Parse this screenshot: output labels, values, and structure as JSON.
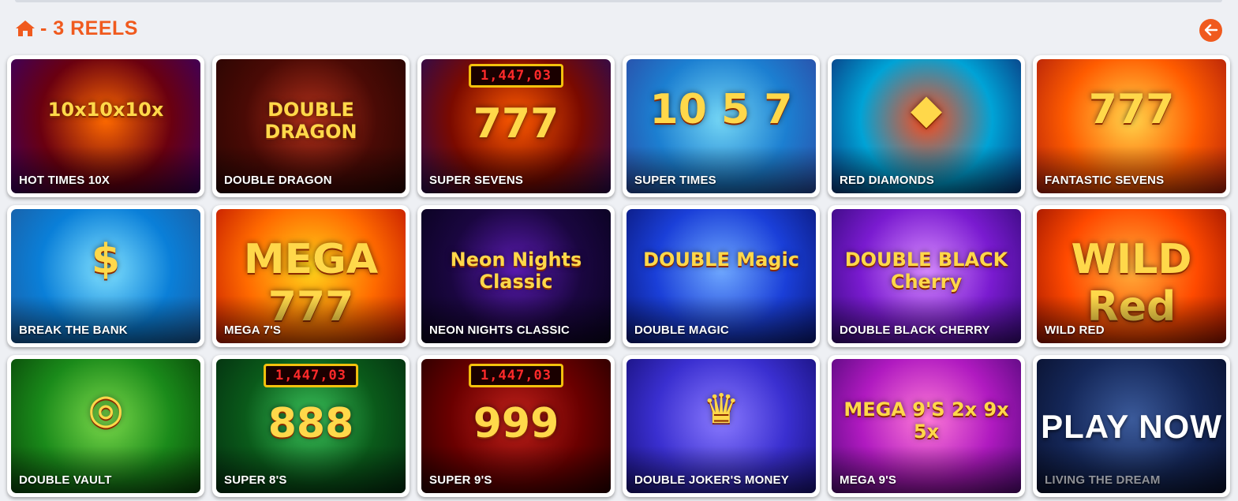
{
  "header": {
    "title": "- 3 REELS",
    "accent_color": "#f05a1e",
    "home_icon": "home-icon",
    "back_icon": "arrow-left-icon"
  },
  "games": [
    {
      "name": "HOT TIMES 10X",
      "art_text": "10x10x10x",
      "colors": [
        "#6a0010",
        "#ff6a00",
        "#3b0060"
      ]
    },
    {
      "name": "DOUBLE DRAGON",
      "art_text": "DOUBLE DRAGON",
      "colors": [
        "#4a0a05",
        "#b1301a",
        "#2a0603"
      ]
    },
    {
      "name": "SUPER SEVENS",
      "art_text": "777",
      "jackpot": "1,447,03",
      "colors": [
        "#7a0a00",
        "#ff5a00",
        "#2b0b50"
      ]
    },
    {
      "name": "SUPER TIMES",
      "art_text": "10 5 7",
      "colors": [
        "#1c7fd1",
        "#74d6f5",
        "#2b4ea8"
      ]
    },
    {
      "name": "RED DIAMONDS",
      "art_text": "◆",
      "colors": [
        "#00a3d6",
        "#ff4a1a",
        "#0a3a82"
      ]
    },
    {
      "name": "FANTASTIC SEVENS",
      "art_text": "777",
      "colors": [
        "#ff5c00",
        "#ffd34a",
        "#b3200a"
      ]
    },
    {
      "name": "BREAK THE BANK",
      "art_text": "$",
      "colors": [
        "#0a7fd8",
        "#7fe0ff",
        "#1b5fa5"
      ]
    },
    {
      "name": "MEGA 7'S",
      "art_text": "MEGA 777",
      "colors": [
        "#ff6a00",
        "#ffd21a",
        "#c41a00"
      ]
    },
    {
      "name": "NEON NIGHTS CLASSIC",
      "art_text": "Neon Nights Classic",
      "colors": [
        "#1a0640",
        "#5a1bb0",
        "#0a0320"
      ]
    },
    {
      "name": "DOUBLE MAGIC",
      "art_text": "DOUBLE Magic",
      "colors": [
        "#1a3fd8",
        "#6fa8ff",
        "#0b1a80"
      ]
    },
    {
      "name": "DOUBLE BLACK CHERRY",
      "art_text": "DOUBLE BLACK Cherry",
      "colors": [
        "#7a1bd0",
        "#d78bff",
        "#3a0a80"
      ]
    },
    {
      "name": "WILD RED",
      "art_text": "WILD Red",
      "colors": [
        "#ff4a00",
        "#ffae3a",
        "#a01500"
      ]
    },
    {
      "name": "DOUBLE VAULT",
      "art_text": "◎",
      "colors": [
        "#1a8a1a",
        "#7ad84a",
        "#0a4a0a"
      ]
    },
    {
      "name": "SUPER 8'S",
      "art_text": "888",
      "jackpot": "1,447,03",
      "colors": [
        "#0a5a1a",
        "#3ac25a",
        "#043010"
      ]
    },
    {
      "name": "SUPER 9'S",
      "art_text": "999",
      "jackpot": "1,447,03",
      "colors": [
        "#6a0000",
        "#c0201a",
        "#2a0000"
      ]
    },
    {
      "name": "DOUBLE JOKER'S MONEY",
      "art_text": "♛",
      "colors": [
        "#3a2fd0",
        "#8a7aff",
        "#1a1280"
      ]
    },
    {
      "name": "MEGA 9'S",
      "art_text": "MEGA 9'S 2x 9x 5x",
      "colors": [
        "#b01ac0",
        "#ff7ad8",
        "#5a0a80"
      ]
    },
    {
      "name": "LIVING THE DREAM",
      "art_text": "PLAY NOW",
      "colors": [
        "#15285a",
        "#3b5a9a",
        "#0a1230"
      ],
      "play_now": true
    }
  ]
}
